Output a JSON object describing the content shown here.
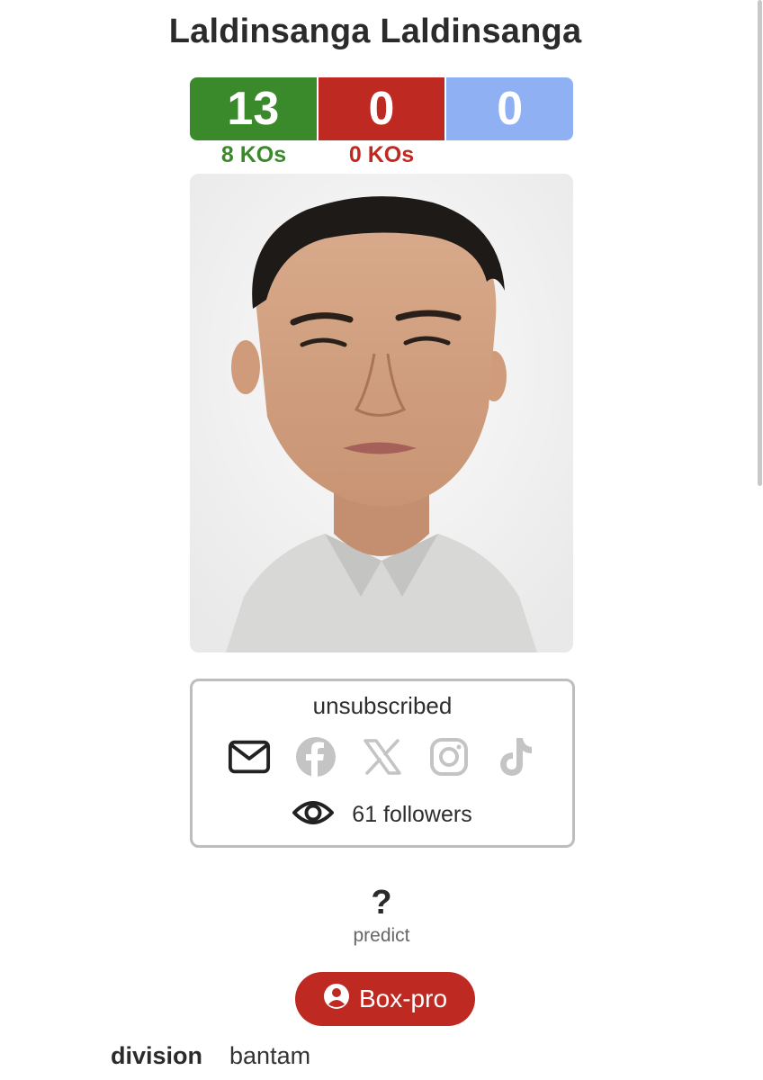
{
  "fighter": {
    "name": "Laldinsanga Laldinsanga"
  },
  "record": {
    "wins": "13",
    "losses": "0",
    "draws": "0",
    "win_kos": "8 KOs",
    "loss_kos": "0 KOs",
    "colors": {
      "win": "#3a8a2c",
      "loss": "#be2a22",
      "draw": "#8fb1f4"
    }
  },
  "photo": {
    "icon": "fighter-portrait"
  },
  "subscription": {
    "status": "unsubscribed",
    "icons": [
      "envelope-icon",
      "facebook-icon",
      "x-icon",
      "instagram-icon",
      "tiktok-icon"
    ],
    "followers": "61 followers"
  },
  "predict": {
    "symbol": "?",
    "label": "predict"
  },
  "category_button": {
    "label": "Box-pro",
    "icon": "user-circle-icon"
  },
  "details": {
    "division_key": "division",
    "division_value": "bantam"
  }
}
